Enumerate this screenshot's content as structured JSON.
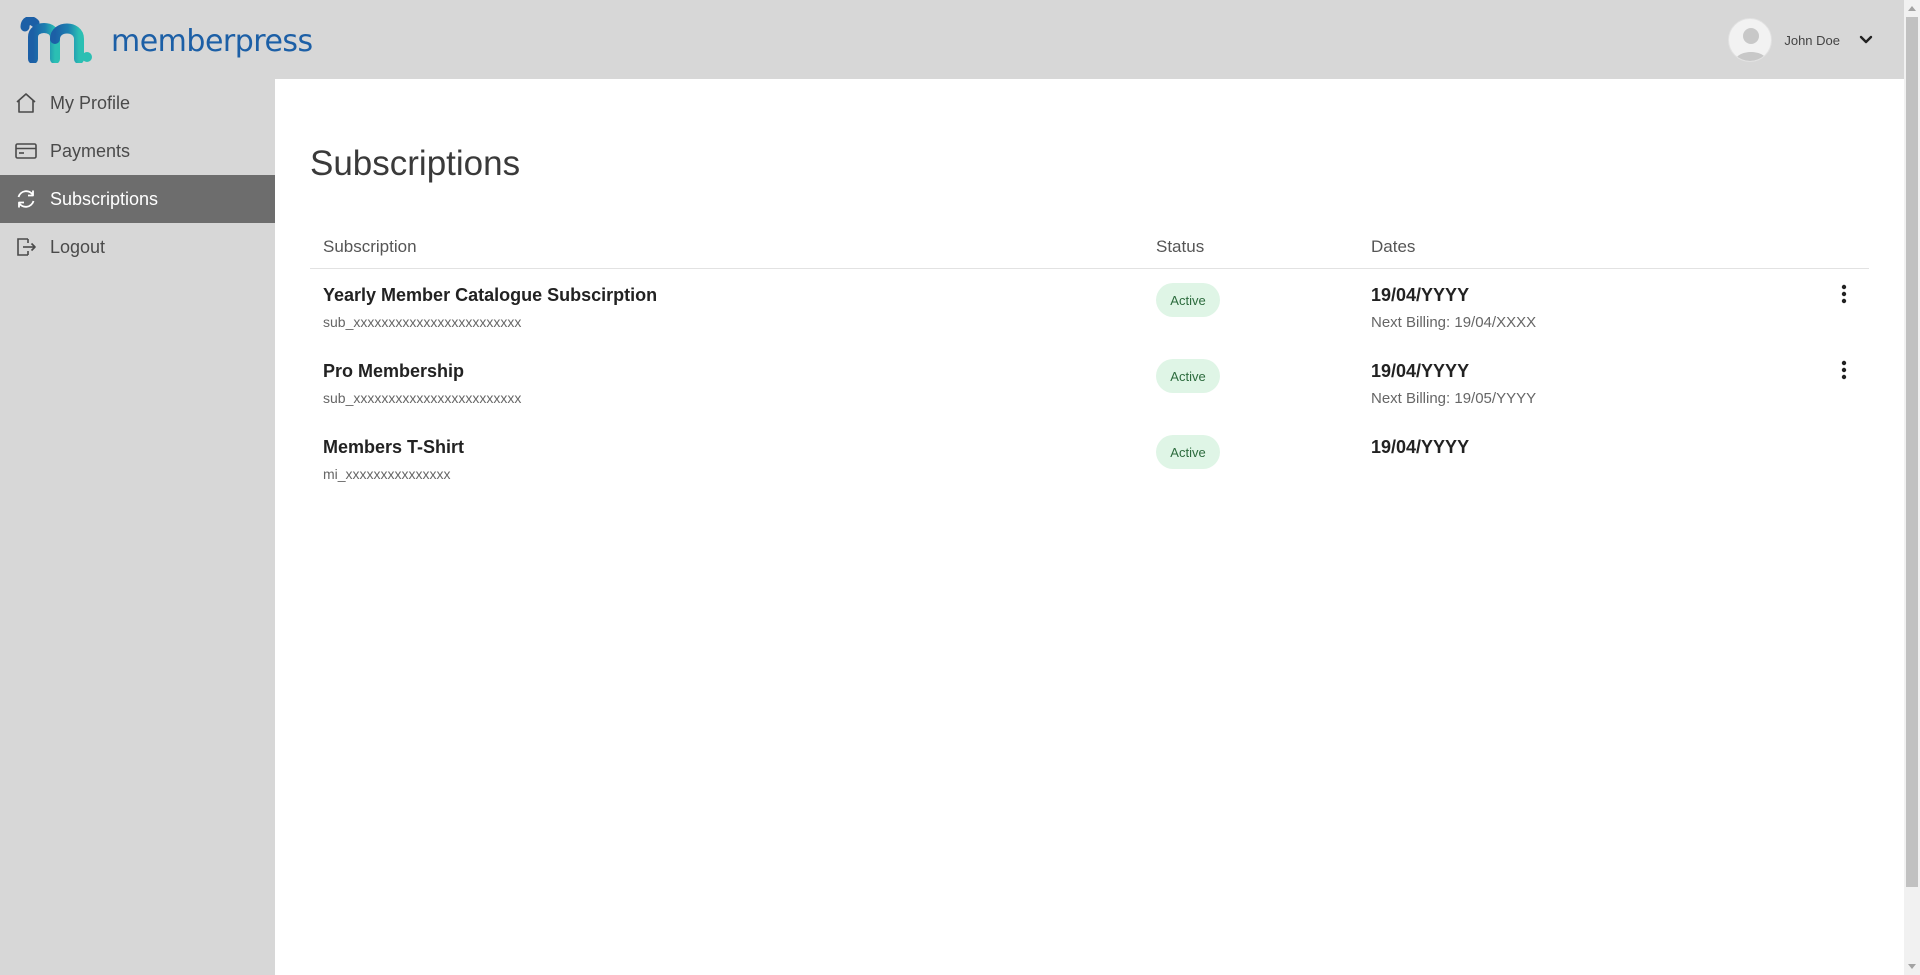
{
  "brand": {
    "name": "memberpress"
  },
  "user": {
    "name": "John Doe"
  },
  "nav": {
    "items": [
      {
        "label": "My Profile",
        "icon": "home-icon"
      },
      {
        "label": "Payments",
        "icon": "credit-card-icon"
      },
      {
        "label": "Subscriptions",
        "icon": "refresh-icon",
        "active": true
      },
      {
        "label": "Logout",
        "icon": "logout-icon"
      }
    ]
  },
  "page": {
    "title": "Subscriptions"
  },
  "table": {
    "headers": {
      "subscription": "Subscription",
      "status": "Status",
      "dates": "Dates"
    },
    "rows": [
      {
        "name": "Yearly Member Catalogue Subscirption",
        "id": "sub_xxxxxxxxxxxxxxxxxxxxxxxx",
        "status": "Active",
        "date": "19/04/YYYY",
        "next_billing": "Next Billing: 19/04/XXXX",
        "has_menu": true
      },
      {
        "name": "Pro Membership",
        "id": "sub_xxxxxxxxxxxxxxxxxxxxxxxx",
        "status": "Active",
        "date": "19/04/YYYY",
        "next_billing": "Next Billing: 19/05/YYYY",
        "has_menu": true
      },
      {
        "name": "Members T-Shirt",
        "id": "mi_xxxxxxxxxxxxxxx",
        "status": "Active",
        "date": "19/04/YYYY",
        "next_billing": "",
        "has_menu": false
      }
    ]
  },
  "colors": {
    "sidebar_bg": "#d7d7d7",
    "active_nav_bg": "#6d6d6d",
    "badge_bg": "#dff5e6",
    "badge_text": "#2c6b3d",
    "brand_blue": "#1c5fa6",
    "brand_teal": "#2bbfb3"
  }
}
